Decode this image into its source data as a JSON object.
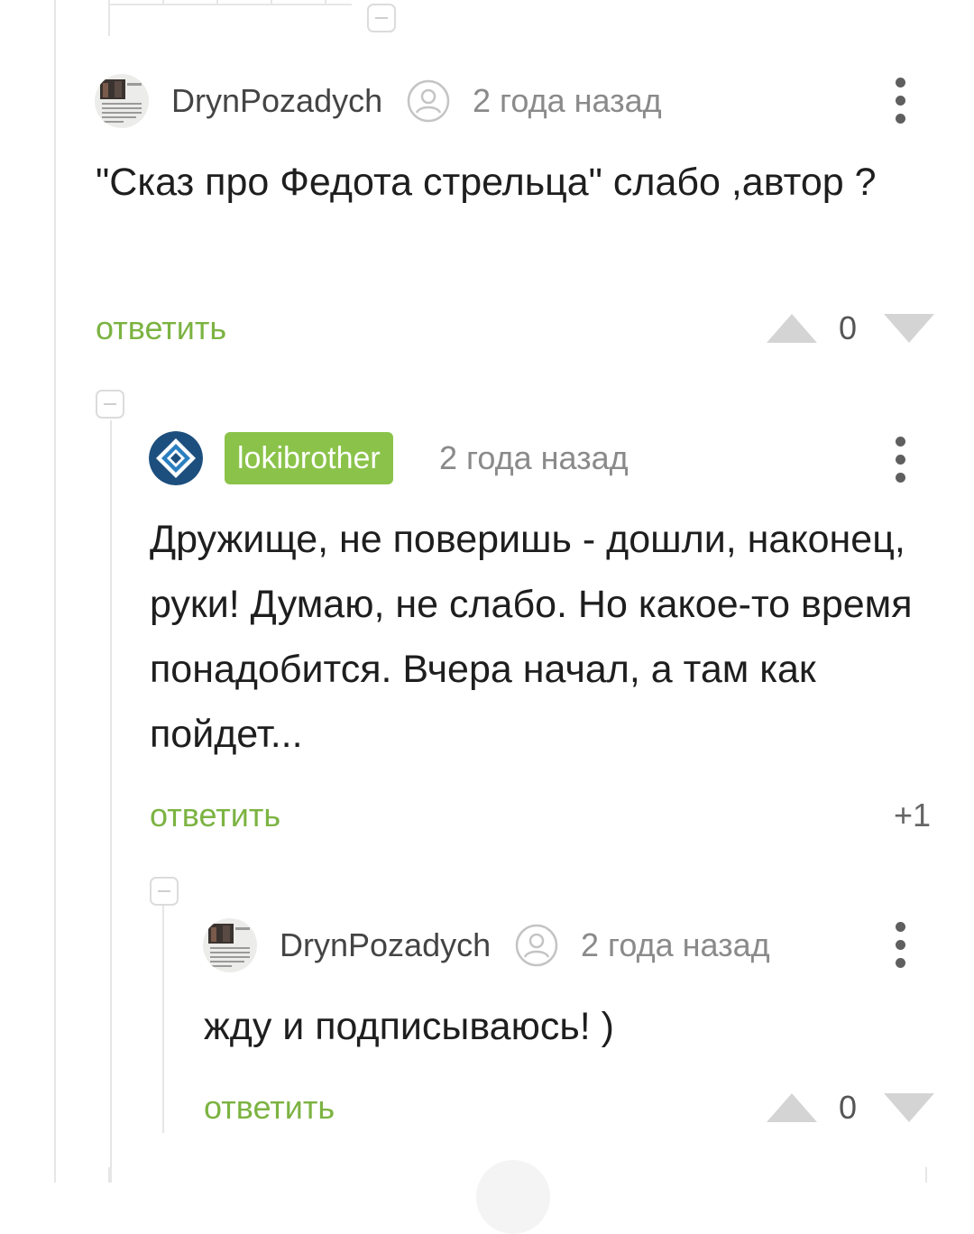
{
  "comments": [
    {
      "author": "DrynPozadych",
      "time": "2 года назад",
      "text": "\"Сказ про Федота стрельца\" слабо ,автор ?",
      "reply_label": "ответить",
      "rating": "0"
    },
    {
      "author": "lokibrother",
      "time": "2 года назад",
      "text": "Дружище, не поверишь - дошли, наконец, руки! Думаю, не слабо. Но какое-то время понадобится. Вчера начал, а там как пойдет...",
      "reply_label": "ответить",
      "rating": "+1"
    },
    {
      "author": "DrynPozadych",
      "time": "2 года назад",
      "text": "жду и подписываюсь! )",
      "reply_label": "ответить",
      "rating": "0"
    }
  ],
  "colors": {
    "accent_green": "#7cb342",
    "badge_green": "#8bc34a",
    "vote_arrow": "#d4d4d4",
    "meta_gray": "#8a8a8a"
  },
  "icons": {
    "author_status": "user-circle-icon",
    "menu": "more-vertical-icon",
    "vote_up": "triangle-up-icon",
    "vote_down": "triangle-down-icon",
    "collapse": "minus-box-icon"
  }
}
